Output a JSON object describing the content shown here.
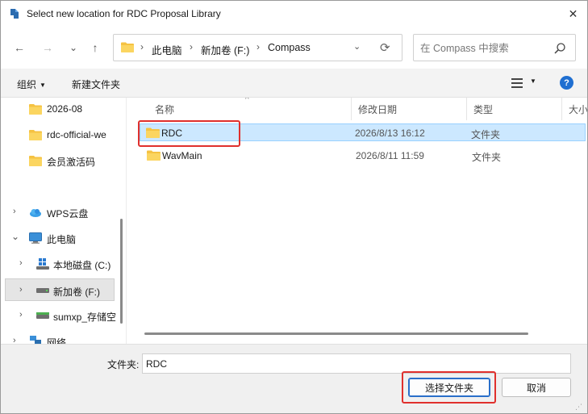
{
  "window": {
    "title": "Select new location for RDC Proposal Library",
    "close_glyph": "✕"
  },
  "nav": {
    "back_glyph": "←",
    "forward_glyph": "→",
    "recent_glyph": "⌄",
    "up_glyph": "↑",
    "breadcrumbs": [
      "此电脑",
      "新加卷 (F:)",
      "Compass"
    ],
    "separator": "›",
    "refresh_glyph": "⟳",
    "dropdown_glyph": "⌄"
  },
  "search": {
    "placeholder": "在 Compass 中搜索"
  },
  "toolbar": {
    "organize_label": "组织",
    "new_folder_label": "新建文件夹",
    "caret_glyph": "▼"
  },
  "sidebar": {
    "items": [
      {
        "label": "2026-08",
        "icon": "folder-icon",
        "level": 1
      },
      {
        "label": "rdc-official-we",
        "icon": "folder-icon",
        "level": 1
      },
      {
        "label": "会员激活码",
        "icon": "folder-icon",
        "level": 1
      },
      {
        "label": "WPS云盘",
        "icon": "cloud-icon",
        "level": 0,
        "expandable": true
      },
      {
        "label": "此电脑",
        "icon": "computer-icon",
        "level": 0,
        "expanded": true
      },
      {
        "label": "本地磁盘 (C:)",
        "icon": "windows-drive-icon",
        "level": 1,
        "expandable": true
      },
      {
        "label": "新加卷 (F:)",
        "icon": "drive-icon",
        "level": 1,
        "expandable": true,
        "selected": true
      },
      {
        "label": "sumxp_存储空",
        "icon": "usb-drive-icon",
        "level": 1,
        "expandable": true
      },
      {
        "label": "网络",
        "icon": "network-icon",
        "level": 0,
        "expandable": true
      }
    ],
    "chevron_right": "›",
    "chevron_down": "⌄"
  },
  "filelist": {
    "columns": [
      "名称",
      "修改日期",
      "类型",
      "大小"
    ],
    "sort_glyph": "^",
    "rows": [
      {
        "name": "RDC",
        "date": "2026/8/13 16:12",
        "type": "文件夹",
        "selected": true
      },
      {
        "name": "WavMain",
        "date": "2026/8/11 11:59",
        "type": "文件夹"
      }
    ]
  },
  "bottom": {
    "folder_label": "文件夹:",
    "folder_value": "RDC",
    "select_button": "选择文件夹",
    "cancel_button": "取消"
  },
  "colors": {
    "accent": "#1f6fd1",
    "selection": "#cce8ff",
    "highlight": "#e0302d",
    "folder": "#f5c242"
  }
}
